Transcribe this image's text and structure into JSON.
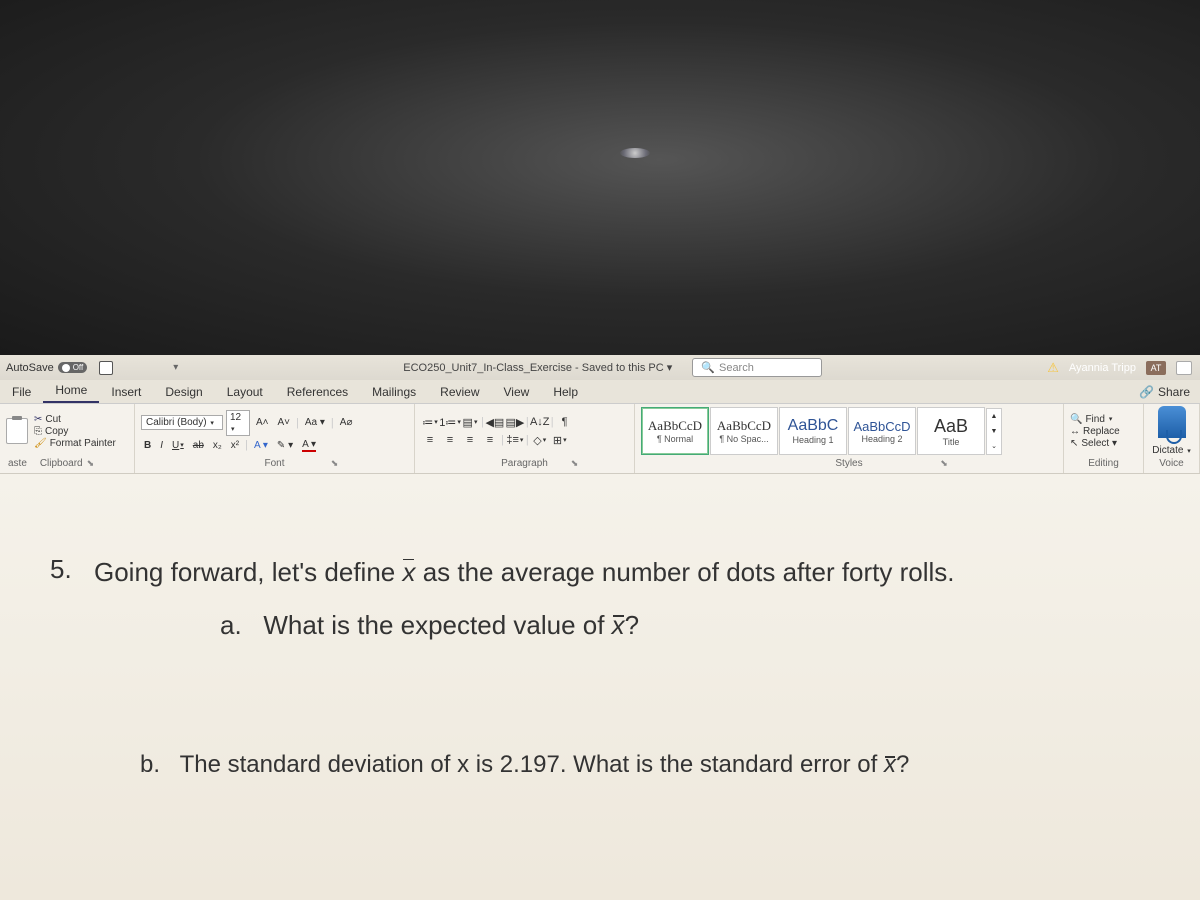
{
  "titlebar": {
    "autosave_label": "AutoSave",
    "autosave_state": "Off",
    "doc_title": "ECO250_Unit7_In-Class_Exercise - Saved to this PC ▾",
    "search_placeholder": "Search",
    "user_name": "Ayannia Tripp",
    "user_initials": "AT"
  },
  "tabs": {
    "items": [
      "File",
      "Home",
      "Insert",
      "Design",
      "Layout",
      "References",
      "Mailings",
      "Review",
      "View",
      "Help"
    ],
    "active": "Home",
    "share": "Share"
  },
  "clipboard": {
    "paste": "aste",
    "cut": "Cut",
    "copy": "Copy",
    "format_painter": "Format Painter",
    "label": "Clipboard"
  },
  "font": {
    "name": "Calibri (Body)",
    "size": "12",
    "grow": "A˄",
    "shrink": "A˅",
    "case": "Aa ▾",
    "clear": "A⌀",
    "bold": "B",
    "italic": "I",
    "underline": "U",
    "strike": "ab",
    "subscript": "x₂",
    "superscript": "x²",
    "effects": "A ▾",
    "highlight": "✎ ▾",
    "color": "A ▾",
    "label": "Font"
  },
  "paragraph": {
    "label": "Paragraph",
    "bullets": "≔",
    "numbering": "1≔",
    "multilevel": "▤",
    "dec_indent": "◀▤",
    "inc_indent": "▤▶",
    "sort": "A↓Z",
    "show": "¶",
    "align_l": "≡",
    "align_c": "≡",
    "align_r": "≡",
    "align_j": "≡",
    "spacing": "‡≡",
    "shading": "◇",
    "borders": "⊞"
  },
  "styles": {
    "items": [
      {
        "sample": "AaBbCcD",
        "name": "¶ Normal",
        "class": ""
      },
      {
        "sample": "AaBbCcD",
        "name": "¶ No Spac...",
        "class": ""
      },
      {
        "sample": "AaBbC",
        "name": "Heading 1",
        "class": "h"
      },
      {
        "sample": "AaBbCcD",
        "name": "Heading 2",
        "class": "h"
      },
      {
        "sample": "AaB",
        "name": "Title",
        "class": "title"
      }
    ],
    "label": "Styles"
  },
  "editing": {
    "find": "Find",
    "replace": "Replace",
    "select": "Select ▾",
    "label": "Editing"
  },
  "voice": {
    "dictate": "Dictate",
    "label": "Voice"
  },
  "doc": {
    "q5_num": "5.",
    "q5_text_a": "Going forward, let's define ",
    "q5_text_b": " as the average number of dots after forty rolls.",
    "qa_label": "a.",
    "qa_text_a": "What is the expected value of ",
    "qa_text_b": "?",
    "qb_label": "b.",
    "qb_text_a": "The standard deviation of x is 2.197. What is the standard error of ",
    "qb_text_b": "?",
    "xbar": "x"
  }
}
